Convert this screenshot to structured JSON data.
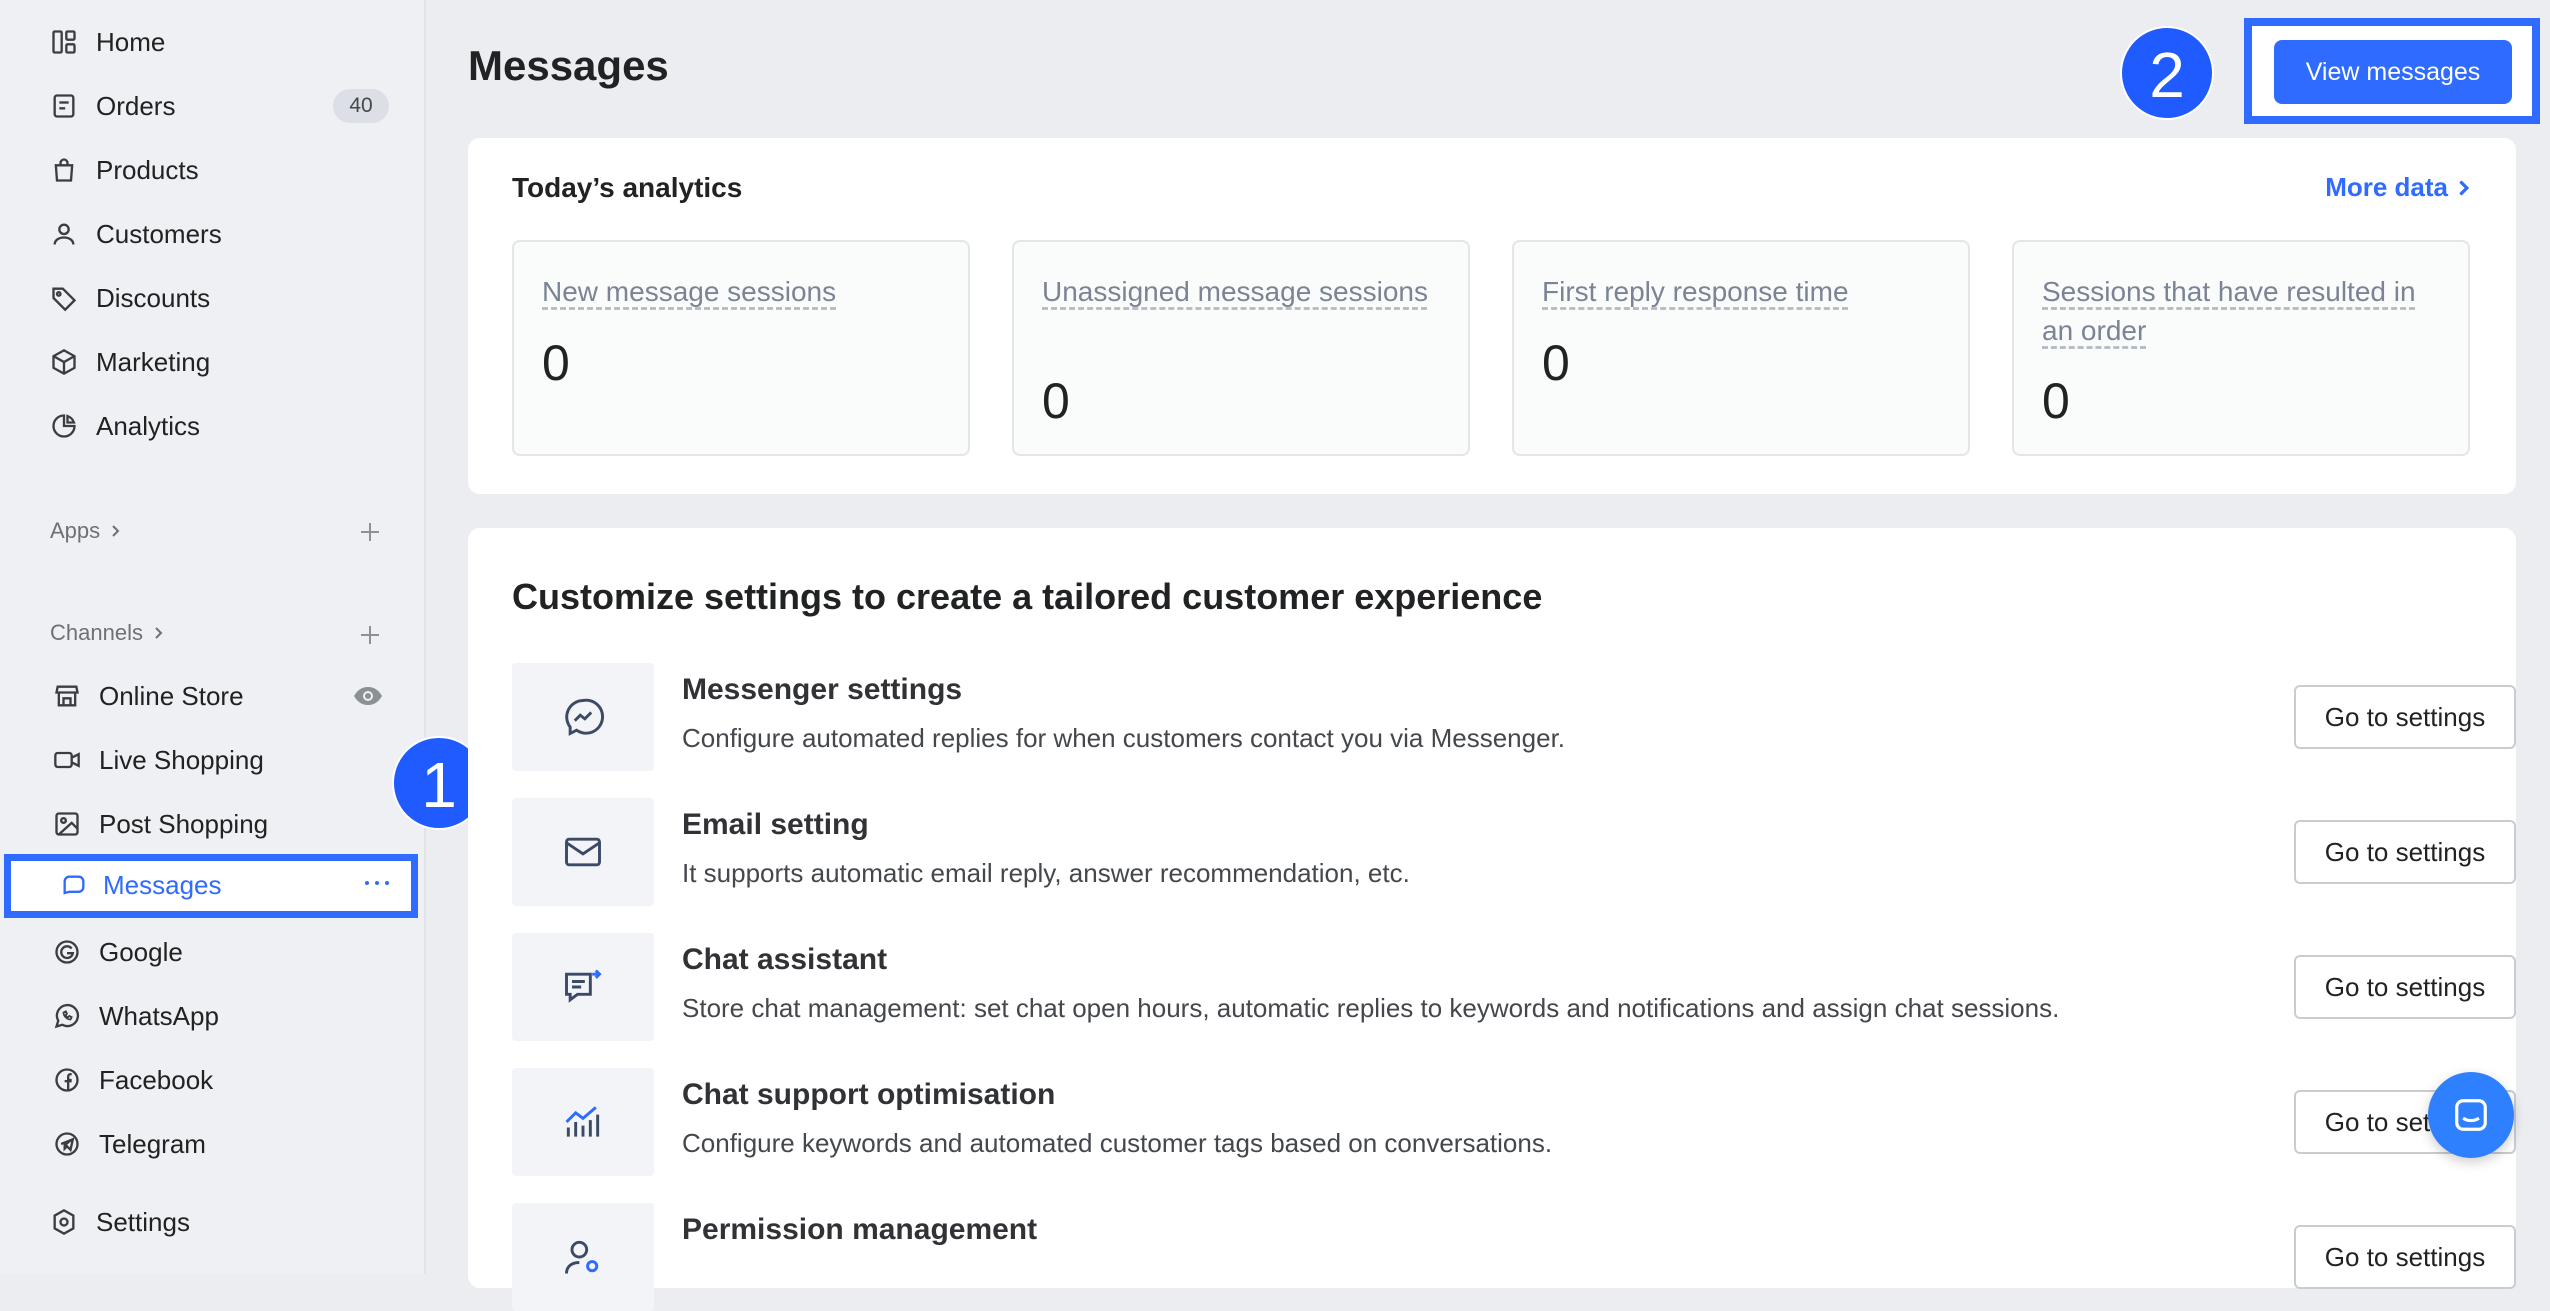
{
  "sidebar": {
    "nav": [
      {
        "label": "Home",
        "icon": "home-icon"
      },
      {
        "label": "Orders",
        "icon": "orders-icon",
        "badge": "40"
      },
      {
        "label": "Products",
        "icon": "products-icon"
      },
      {
        "label": "Customers",
        "icon": "customers-icon"
      },
      {
        "label": "Discounts",
        "icon": "discounts-icon"
      },
      {
        "label": "Marketing",
        "icon": "marketing-icon"
      },
      {
        "label": "Analytics",
        "icon": "analytics-icon"
      }
    ],
    "apps_label": "Apps",
    "channels_label": "Channels",
    "channels": [
      {
        "label": "Online Store",
        "icon": "store-icon"
      },
      {
        "label": "Live Shopping",
        "icon": "video-icon"
      },
      {
        "label": "Post Shopping",
        "icon": "image-icon"
      },
      {
        "label": "Messages",
        "icon": "chat-icon",
        "active": true
      },
      {
        "label": "Google",
        "icon": "google-icon"
      },
      {
        "label": "WhatsApp",
        "icon": "whatsapp-icon"
      },
      {
        "label": "Facebook",
        "icon": "facebook-icon"
      },
      {
        "label": "Telegram",
        "icon": "telegram-icon"
      }
    ],
    "settings_label": "Settings"
  },
  "callouts": {
    "one": "1",
    "two": "2"
  },
  "header": {
    "title": "Messages",
    "view_messages_label": "View messages"
  },
  "analytics": {
    "title": "Today’s analytics",
    "more_label": "More data",
    "stats": [
      {
        "label": "New message sessions",
        "value": "0"
      },
      {
        "label": "Unassigned message sessions",
        "value": "0"
      },
      {
        "label": "First reply response time",
        "value": "0"
      },
      {
        "label": "Sessions that have resulted in an order",
        "value": "0"
      }
    ]
  },
  "settings": {
    "title": "Customize settings to create a tailored customer experience",
    "button_label": "Go to settings",
    "rows": [
      {
        "title": "Messenger settings",
        "desc": "Configure automated replies for when customers contact you via Messenger.",
        "icon": "messenger-icon"
      },
      {
        "title": "Email setting",
        "desc": "It supports automatic email reply, answer recommendation, etc.",
        "icon": "mail-icon"
      },
      {
        "title": "Chat assistant",
        "desc": "Store chat management: set chat open hours, automatic replies to keywords and notifications and assign chat sessions.",
        "icon": "chat-assistant-icon"
      },
      {
        "title": "Chat support optimisation",
        "desc": "Configure keywords and automated customer tags based on conversations.",
        "icon": "chart-icon"
      },
      {
        "title": "Permission management",
        "desc": "",
        "icon": "user-permission-icon"
      }
    ]
  },
  "colors": {
    "accent": "#2f6bff",
    "highlight_border": "#2f6bff",
    "sidebar_bg": "#eff0f3",
    "page_bg": "#ecedf1"
  }
}
